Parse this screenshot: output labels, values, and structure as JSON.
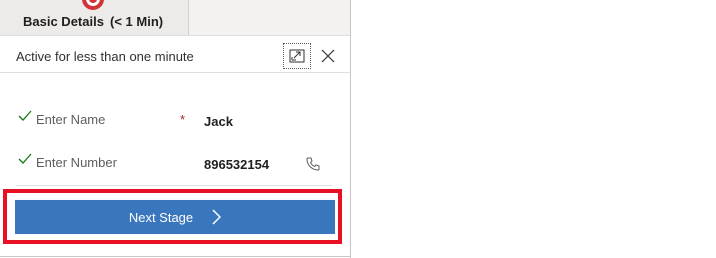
{
  "stage": {
    "title": "Basic Details",
    "duration": "(< 1 Min)",
    "status": "Active for less than one minute"
  },
  "icons": {
    "expand": "expand-icon",
    "close": "close-icon",
    "check": "checkmark-icon",
    "phone": "phone-icon",
    "next": "chevron-right-icon",
    "stage_marker": "stage-marker-icon"
  },
  "fields": [
    {
      "label": "Enter Name",
      "required": "*",
      "value": "Jack"
    },
    {
      "label": "Enter Number",
      "value": "896532154"
    }
  ],
  "actions": {
    "next_label": "Next Stage"
  },
  "colors": {
    "accent": "#3a76bd",
    "highlight": "#e81123",
    "stage_marker": "#d13438"
  }
}
